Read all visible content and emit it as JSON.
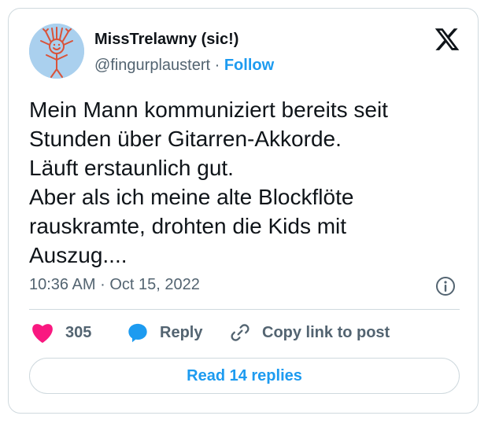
{
  "author": {
    "display_name": "MissTrelawny (sic!)",
    "handle": "@fingurplaustert",
    "separator": "·",
    "follow_label": "Follow",
    "avatar_icon": "stick-figure-drawing-icon"
  },
  "brand": {
    "logo_icon": "x-logo-icon"
  },
  "tweet": {
    "lines": [
      "Mein Mann kommuniziert bereits seit",
      "Stunden über Gitarren-Akkorde.",
      "Läuft erstaunlich gut.",
      "Aber als ich meine alte Blockflöte",
      "rauskramte, drohten die Kids mit",
      "Auszug...."
    ],
    "time": "10:36 AM",
    "separator": "·",
    "date": "Oct 15, 2022",
    "info_icon": "info-icon"
  },
  "actions": {
    "like_count": "305",
    "reply_label": "Reply",
    "copy_label": "Copy link to post"
  },
  "footer": {
    "read_replies_label": "Read 14 replies"
  },
  "colors": {
    "accent": "#1d9bf0",
    "heart": "#f91880",
    "text": "#0f1419",
    "muted": "#536471",
    "border": "#cfd9de",
    "avatar_bg": "#aad0ee"
  }
}
